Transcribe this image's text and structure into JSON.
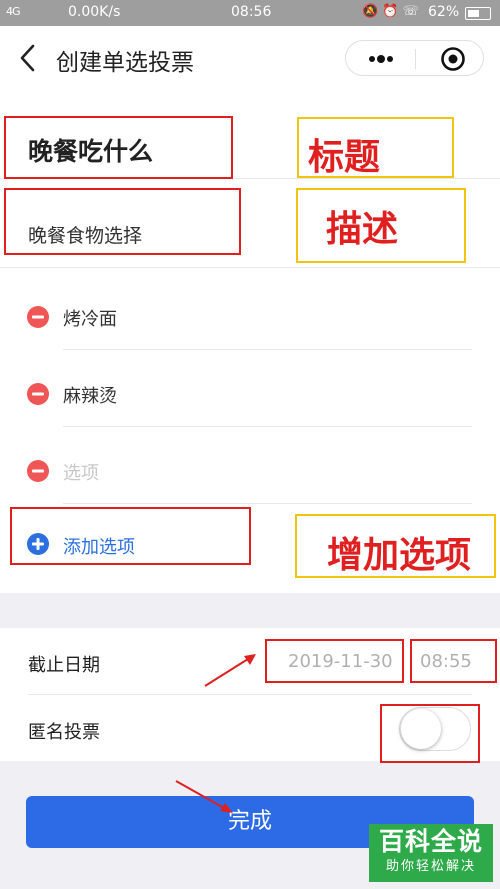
{
  "status_bar": {
    "signal": "4G",
    "speed": "0.00K/s",
    "time": "08:56",
    "icons": "🔕 ⏰ ☏",
    "battery": "62%",
    "battery_level": 0.62
  },
  "nav": {
    "title": "创建单选投票",
    "back_icon": "chevron-left-icon",
    "more_icon": "more-dots-icon",
    "close_icon": "target-close-icon"
  },
  "form": {
    "title_value": "晚餐吃什么",
    "description_value": "晚餐食物选择",
    "options": [
      {
        "text": "烤冷面",
        "is_placeholder": false
      },
      {
        "text": "麻辣烫",
        "is_placeholder": false
      },
      {
        "text": "选项",
        "is_placeholder": true
      }
    ],
    "add_option_label": "添加选项"
  },
  "settings": {
    "deadline_label": "截止日期",
    "deadline_date": "2019-11-30",
    "deadline_time": "08:55",
    "anonymous_label": "匿名投票",
    "anonymous_enabled": false
  },
  "done_button": "完成",
  "annotations": {
    "title_tag": "标题",
    "description_tag": "描述",
    "add_option_tag": "增加选项"
  },
  "watermark": {
    "main": "百科全说",
    "sub": "助你轻松解决"
  },
  "colors": {
    "accent": "#2d6be6",
    "remove": "#f05656",
    "annotation_red": "#e02020",
    "annotation_yellow": "#f1c40f",
    "watermark_green": "#2eaa4a"
  }
}
